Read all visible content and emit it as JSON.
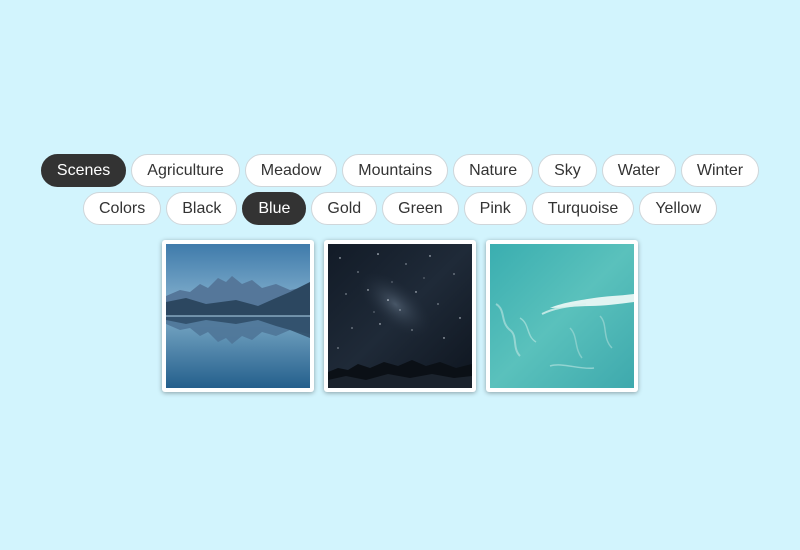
{
  "scenes_filters": [
    {
      "label": "Scenes",
      "active": true
    },
    {
      "label": "Agriculture",
      "active": false
    },
    {
      "label": "Meadow",
      "active": false
    },
    {
      "label": "Mountains",
      "active": false
    },
    {
      "label": "Nature",
      "active": false
    },
    {
      "label": "Sky",
      "active": false
    },
    {
      "label": "Water",
      "active": false
    },
    {
      "label": "Winter",
      "active": false
    }
  ],
  "colors_filters": [
    {
      "label": "Colors",
      "active": false
    },
    {
      "label": "Black",
      "active": false
    },
    {
      "label": "Blue",
      "active": true
    },
    {
      "label": "Gold",
      "active": false
    },
    {
      "label": "Green",
      "active": false
    },
    {
      "label": "Pink",
      "active": false
    },
    {
      "label": "Turquoise",
      "active": false
    },
    {
      "label": "Yellow",
      "active": false
    }
  ],
  "gallery": [
    {
      "subject": "mountain-lake-reflection"
    },
    {
      "subject": "night-sky-milky-way"
    },
    {
      "subject": "turquoise-ocean-wave"
    }
  ],
  "colors": {
    "background": "#d2f4fd",
    "active_pill": "#333333",
    "pill": "#ffffff"
  }
}
